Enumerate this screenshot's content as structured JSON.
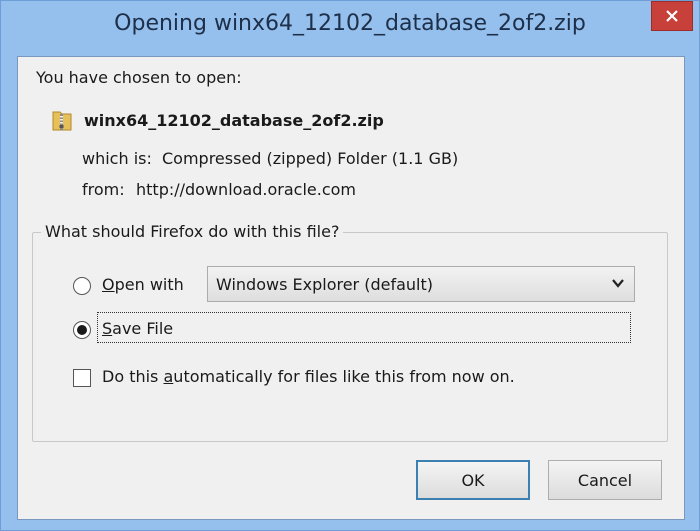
{
  "window": {
    "title": "Opening winx64_12102_database_2of2.zip"
  },
  "dialog": {
    "chosen_label": "You have chosen to open:",
    "file_name": "winx64_12102_database_2of2.zip",
    "type_key": "which is:",
    "type_value": "Compressed (zipped) Folder (1.1 GB)",
    "from_key": "from:",
    "from_value": "http://download.oracle.com"
  },
  "group": {
    "legend": "What should Firefox do with this file?",
    "open_with": {
      "prefix_u": "O",
      "rest": "pen with",
      "checked": false
    },
    "open_with_select": {
      "selected": "Windows Explorer (default)"
    },
    "save_file": {
      "prefix_u": "S",
      "rest": "ave File",
      "checked": true
    },
    "auto": {
      "before": "Do this ",
      "underline": "a",
      "after": "utomatically for files like this from now on.",
      "checked": false
    }
  },
  "buttons": {
    "ok": "OK",
    "cancel": "Cancel"
  },
  "colors": {
    "title_bg": "#95bfec",
    "close_bg": "#c7403a",
    "client_bg": "#f0f0f0",
    "default_button_border": "#3c7fb1"
  },
  "icons": {
    "zip": "zip-folder-icon",
    "close": "close-icon",
    "dropdown": "chevron-down-icon"
  }
}
